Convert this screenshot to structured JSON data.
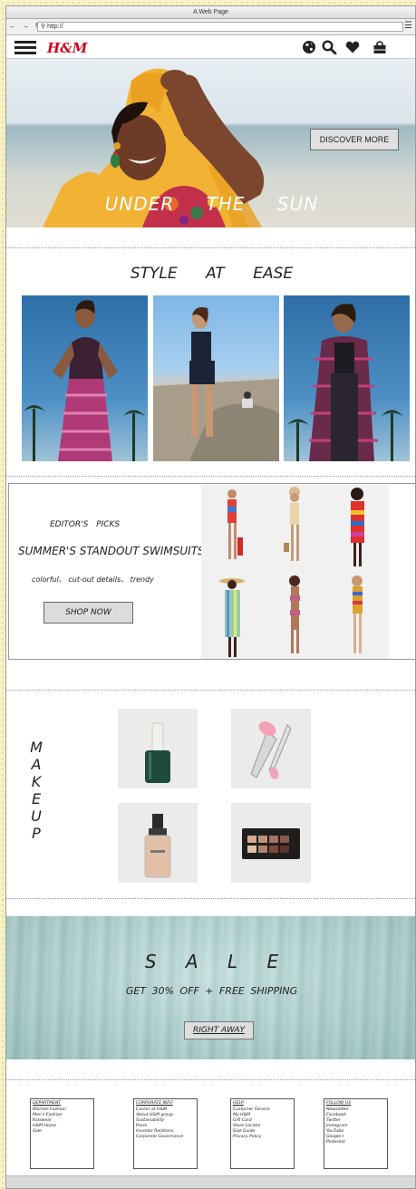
{
  "browser": {
    "title": "A Web Page",
    "url": "http://",
    "nav_icons": "← → ↻"
  },
  "header": {
    "logo": "H&M",
    "icons": [
      "globe-icon",
      "search-icon",
      "heart-icon",
      "shopping-bag-icon"
    ]
  },
  "hero": {
    "button_label": "DISCOVER MORE",
    "title": "UNDER THE SUN"
  },
  "style_section": {
    "title": "STYLE AT EASE"
  },
  "editors": {
    "label": "EDITOR'S PICKS",
    "headline": "SUMMER'S STANDOUT SWIMSUITS",
    "tags": "colorful、 cut-out details、 trendy",
    "button_label": "SHOP NOW"
  },
  "makeup": {
    "letters": [
      "M",
      "A",
      "K",
      "E",
      "U",
      "P"
    ]
  },
  "sale": {
    "title": "S A L E",
    "subtitle": "GET 30% OFF + FREE SHIPPING",
    "button_label": "RIGHT AWAY"
  },
  "footer": {
    "columns": [
      {
        "heading": "DEPARTMENT",
        "items": [
          "Women Fashion",
          "Men's Fashion",
          "Kidswear",
          "H&M Home",
          "Sale"
        ]
      },
      {
        "heading": "CORPORATE INFO",
        "items": [
          "Career at H&M",
          "About H&M group",
          "Sustainability",
          "Press",
          "Investor Relations",
          "Corporate Governance"
        ]
      },
      {
        "heading": "HELP",
        "items": [
          "Customer Service",
          "My H&M",
          "Gift Card",
          "Store Locator",
          "Size Guide",
          "Privacy Policy"
        ]
      },
      {
        "heading": "FOLLOW US",
        "items": [
          "Newsletter",
          "Facebook",
          "Twitter",
          "Instagram",
          "YouTube",
          "Google+",
          "Pinterest"
        ]
      }
    ]
  },
  "colors": {
    "brand": "#d0021b",
    "sale_bg": "#a9cdcb",
    "page_bg": "#f7f2c8"
  }
}
